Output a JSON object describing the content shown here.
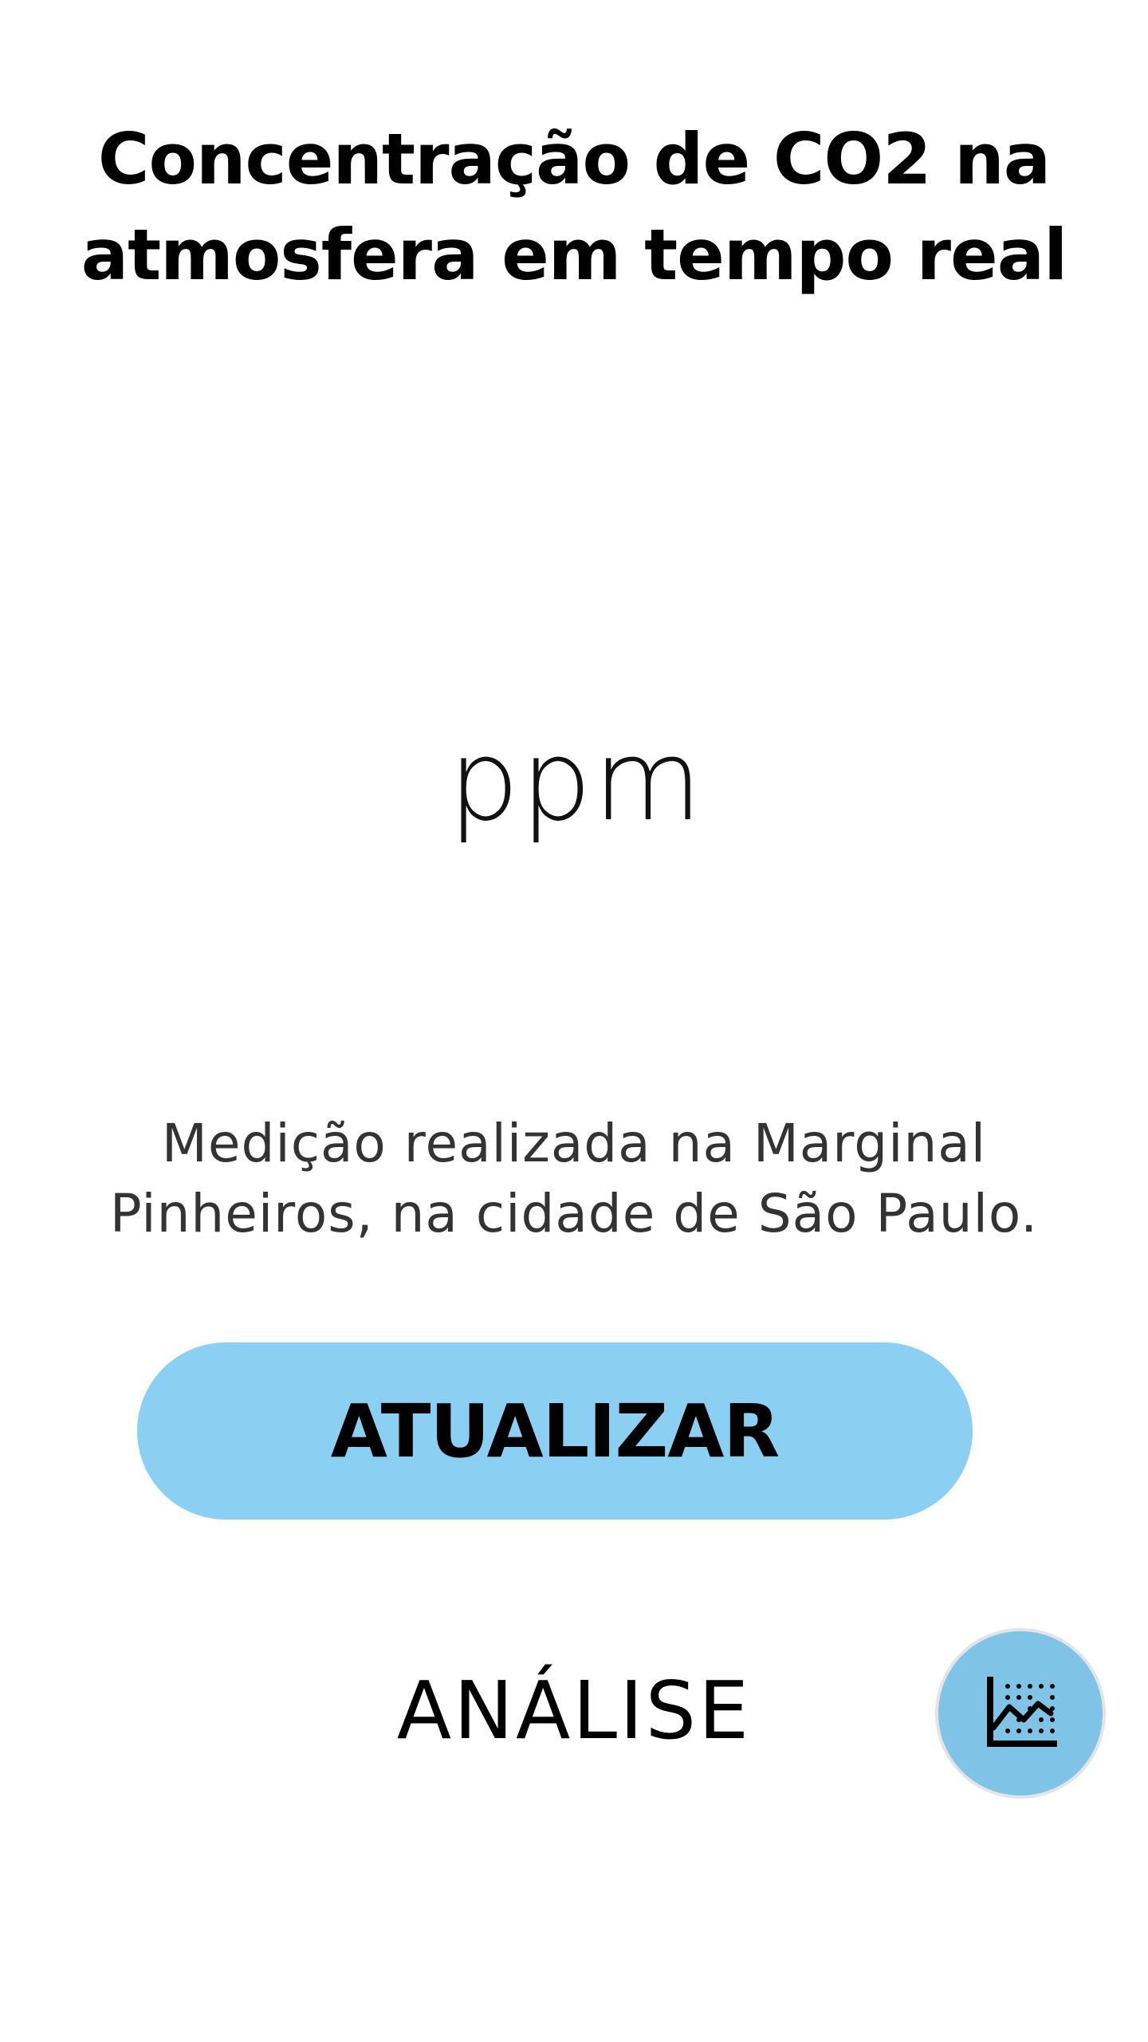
{
  "header": {
    "title": "Concentração de CO2 na atmosfera em tempo real"
  },
  "reading": {
    "value": "",
    "unit": "ppm"
  },
  "location": {
    "text": "Medição realizada na Marginal Pinheiros, na cidade de São Paulo."
  },
  "actions": {
    "update_label": "ATUALIZAR",
    "analysis_label": "ANÁLISE"
  },
  "fab": {
    "icon": "chart-icon"
  },
  "colors": {
    "button_bg": "#8bd0f3",
    "fab_bg": "#7fc3e6",
    "text": "#000000"
  }
}
